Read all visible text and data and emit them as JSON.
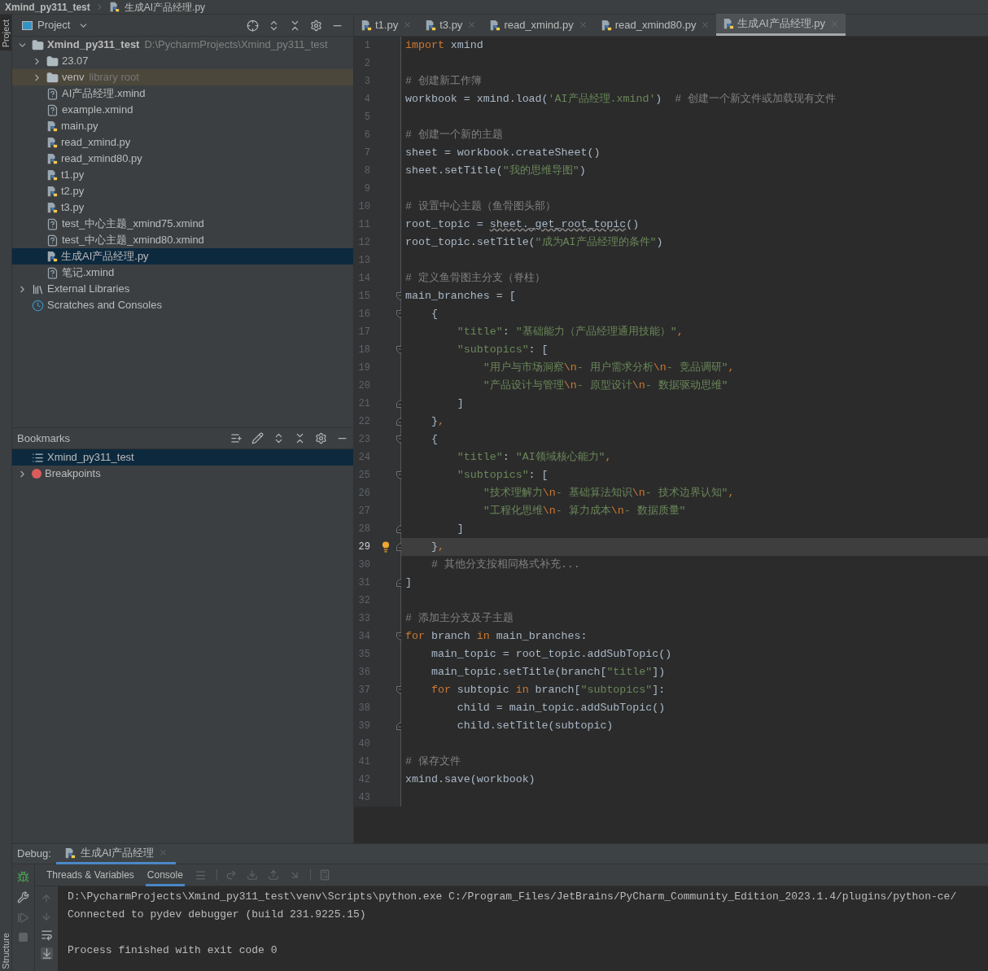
{
  "breadcrumb": [
    {
      "label": "Xmind_py311_test",
      "kind": "project"
    },
    {
      "label": "生成AI产品经理.py",
      "kind": "py"
    }
  ],
  "side_tabs": {
    "top": "Project",
    "bottom": "Structure"
  },
  "project_panel": {
    "title": "Project",
    "tree": [
      {
        "label": "Xmind_py311_test",
        "path": "D:\\PycharmProjects\\Xmind_py311_test",
        "kind": "folder",
        "expanded": true,
        "selected": false,
        "children": [
          {
            "label": "23.07",
            "kind": "folder",
            "expanded": false,
            "selected": false
          },
          {
            "label": "venv",
            "hint": "library root",
            "kind": "libfolder",
            "expanded": false,
            "selected": false
          },
          {
            "label": "AI产品经理.xmind",
            "kind": "other",
            "selected": false
          },
          {
            "label": "example.xmind",
            "kind": "other",
            "selected": false
          },
          {
            "label": "main.py",
            "kind": "py",
            "selected": false
          },
          {
            "label": "read_xmind.py",
            "kind": "py",
            "selected": false
          },
          {
            "label": "read_xmind80.py",
            "kind": "py",
            "selected": false
          },
          {
            "label": "t1.py",
            "kind": "py",
            "selected": false
          },
          {
            "label": "t2.py",
            "kind": "py",
            "selected": false
          },
          {
            "label": "t3.py",
            "kind": "py",
            "selected": false
          },
          {
            "label": "test_中心主题_xmind75.xmind",
            "kind": "other",
            "selected": false
          },
          {
            "label": "test_中心主题_xmind80.xmind",
            "kind": "other",
            "selected": false
          },
          {
            "label": "生成AI产品经理.py",
            "kind": "py",
            "selected": true
          },
          {
            "label": "笔记.xmind",
            "kind": "other",
            "selected": false
          }
        ]
      },
      {
        "label": "External Libraries",
        "kind": "libraries",
        "expanded": false,
        "selected": false
      },
      {
        "label": "Scratches and Consoles",
        "kind": "scratches",
        "selected": false
      }
    ]
  },
  "bookmarks_panel": {
    "title": "Bookmarks",
    "items": [
      {
        "label": "Xmind_py311_test",
        "kind": "list",
        "selected": true
      },
      {
        "label": "Breakpoints",
        "kind": "breakpoints",
        "expanded": false,
        "selected": false
      }
    ]
  },
  "tabs": [
    {
      "label": "t1.py",
      "selected": false
    },
    {
      "label": "t3.py",
      "selected": false
    },
    {
      "label": "read_xmind.py",
      "selected": false
    },
    {
      "label": "read_xmind80.py",
      "selected": false
    },
    {
      "label": "生成AI产品经理.py",
      "selected": true
    }
  ],
  "editor": {
    "lines": [
      {
        "n": "1",
        "current": false,
        "code": [
          {
            "kind": "kw",
            "text": "import"
          },
          {
            "kind": "id",
            "text": " xmind"
          }
        ]
      },
      {
        "n": "2",
        "current": false
      },
      {
        "n": "3",
        "current": false,
        "code": [
          {
            "kind": "cm",
            "text": "# 创建新工作簿"
          }
        ]
      },
      {
        "n": "4",
        "current": false,
        "code": [
          {
            "kind": "id",
            "text": "workbook = xmind.load("
          },
          {
            "kind": "str",
            "text": "'AI产品经理.xmind'"
          },
          {
            "kind": "id",
            "text": ")  "
          },
          {
            "kind": "cm",
            "text": "# 创建一个新文件或加载现有文件"
          }
        ]
      },
      {
        "n": "5",
        "current": false
      },
      {
        "n": "6",
        "current": false,
        "code": [
          {
            "kind": "cm",
            "text": "# 创建一个新的主题"
          }
        ]
      },
      {
        "n": "7",
        "current": false,
        "code": [
          {
            "kind": "id",
            "text": "sheet = workbook.createSheet()"
          }
        ]
      },
      {
        "n": "8",
        "current": false,
        "code": [
          {
            "kind": "id",
            "text": "sheet.setTitle("
          },
          {
            "kind": "str",
            "text": "\"我的思维导图\""
          },
          {
            "kind": "id",
            "text": ")"
          }
        ]
      },
      {
        "n": "9",
        "current": false
      },
      {
        "n": "10",
        "current": false,
        "code": [
          {
            "kind": "cm",
            "text": "# 设置中心主题（鱼骨图头部）"
          }
        ]
      },
      {
        "n": "11",
        "current": false,
        "code": [
          {
            "kind": "id",
            "text": "root_topic = "
          },
          {
            "kind": "warn",
            "text": "sheet._get_root_topic"
          },
          {
            "kind": "id",
            "text": "()"
          }
        ]
      },
      {
        "n": "12",
        "current": false,
        "code": [
          {
            "kind": "id",
            "text": "root_topic.setTitle("
          },
          {
            "kind": "str",
            "text": "\"成为AI产品经理的条件\""
          },
          {
            "kind": "id",
            "text": ")"
          }
        ]
      },
      {
        "n": "13",
        "current": false
      },
      {
        "n": "14",
        "current": false,
        "code": [
          {
            "kind": "cm",
            "text": "# 定义鱼骨图主分支（脊柱）"
          }
        ]
      },
      {
        "n": "15",
        "current": false,
        "kind": "fold-start",
        "code": [
          {
            "kind": "id",
            "text": "main_branches = ["
          }
        ]
      },
      {
        "n": "16",
        "current": false,
        "kind": "fold-start",
        "code": [
          {
            "kind": "id",
            "text": "    {"
          }
        ]
      },
      {
        "n": "17",
        "current": false,
        "code": [
          {
            "kind": "str",
            "text": "        \"title\""
          },
          {
            "kind": "id",
            "text": ": "
          },
          {
            "kind": "str",
            "text": "\"基础能力（产品经理通用技能）\""
          },
          {
            "kind": "kw",
            "text": ","
          }
        ]
      },
      {
        "n": "18",
        "current": false,
        "kind": "fold-start",
        "code": [
          {
            "kind": "str",
            "text": "        \"subtopics\""
          },
          {
            "kind": "id",
            "text": ": ["
          }
        ]
      },
      {
        "n": "19",
        "current": false,
        "code": [
          {
            "kind": "str",
            "text": "            \"用户与市场洞察"
          },
          {
            "kind": "kw",
            "text": "\\n"
          },
          {
            "kind": "str",
            "text": "- 用户需求分析"
          },
          {
            "kind": "kw",
            "text": "\\n"
          },
          {
            "kind": "str",
            "text": "- 竞品调研\""
          },
          {
            "kind": "kw",
            "text": ","
          }
        ]
      },
      {
        "n": "20",
        "current": false,
        "code": [
          {
            "kind": "str",
            "text": "            \"产品设计与管理"
          },
          {
            "kind": "kw",
            "text": "\\n"
          },
          {
            "kind": "str",
            "text": "- 原型设计"
          },
          {
            "kind": "kw",
            "text": "\\n"
          },
          {
            "kind": "str",
            "text": "- 数据驱动思维\""
          }
        ]
      },
      {
        "n": "21",
        "current": false,
        "kind": "fold-end",
        "code": [
          {
            "kind": "id",
            "text": "        ]"
          }
        ]
      },
      {
        "n": "22",
        "current": false,
        "kind": "fold-end",
        "code": [
          {
            "kind": "id",
            "text": "    }"
          },
          {
            "kind": "kw",
            "text": ","
          }
        ]
      },
      {
        "n": "23",
        "current": false,
        "kind": "fold-start",
        "code": [
          {
            "kind": "id",
            "text": "    {"
          }
        ]
      },
      {
        "n": "24",
        "current": false,
        "code": [
          {
            "kind": "str",
            "text": "        \"title\""
          },
          {
            "kind": "id",
            "text": ": "
          },
          {
            "kind": "str",
            "text": "\"AI领域核心能力\""
          },
          {
            "kind": "kw",
            "text": ","
          }
        ]
      },
      {
        "n": "25",
        "current": false,
        "kind": "fold-start",
        "code": [
          {
            "kind": "str",
            "text": "        \"subtopics\""
          },
          {
            "kind": "id",
            "text": ": ["
          }
        ]
      },
      {
        "n": "26",
        "current": false,
        "code": [
          {
            "kind": "str",
            "text": "            \"技术理解力"
          },
          {
            "kind": "kw",
            "text": "\\n"
          },
          {
            "kind": "str",
            "text": "- 基础算法知识"
          },
          {
            "kind": "kw",
            "text": "\\n"
          },
          {
            "kind": "str",
            "text": "- 技术边界认知\""
          },
          {
            "kind": "kw",
            "text": ","
          }
        ]
      },
      {
        "n": "27",
        "current": false,
        "code": [
          {
            "kind": "str",
            "text": "            \"工程化思维"
          },
          {
            "kind": "kw",
            "text": "\\n"
          },
          {
            "kind": "str",
            "text": "- 算力成本"
          },
          {
            "kind": "kw",
            "text": "\\n"
          },
          {
            "kind": "str",
            "text": "- 数据质量\""
          }
        ]
      },
      {
        "n": "28",
        "current": false,
        "kind": "fold-end",
        "code": [
          {
            "kind": "id",
            "text": "        ]"
          }
        ]
      },
      {
        "n": "29",
        "current": true,
        "bulb": true,
        "kind": "fold-end",
        "code": [
          {
            "kind": "id",
            "text": "    }"
          },
          {
            "kind": "kw",
            "text": ","
          }
        ]
      },
      {
        "n": "30",
        "current": false,
        "code": [
          {
            "kind": "cm",
            "text": "    # 其他分支按相同格式补充..."
          }
        ]
      },
      {
        "n": "31",
        "current": false,
        "kind": "fold-end",
        "code": [
          {
            "kind": "id",
            "text": "]"
          }
        ]
      },
      {
        "n": "32",
        "current": false
      },
      {
        "n": "33",
        "current": false,
        "code": [
          {
            "kind": "cm",
            "text": "# 添加主分支及子主题"
          }
        ]
      },
      {
        "n": "34",
        "current": false,
        "kind": "fold-start",
        "code": [
          {
            "kind": "kw",
            "text": "for"
          },
          {
            "kind": "id",
            "text": " branch "
          },
          {
            "kind": "kw",
            "text": "in"
          },
          {
            "kind": "id",
            "text": " main_branches:"
          }
        ]
      },
      {
        "n": "35",
        "current": false,
        "code": [
          {
            "kind": "id",
            "text": "    main_topic = root_topic.addSubTopic()"
          }
        ]
      },
      {
        "n": "36",
        "current": false,
        "code": [
          {
            "kind": "id",
            "text": "    main_topic.setTitle(branch["
          },
          {
            "kind": "str",
            "text": "\"title\""
          },
          {
            "kind": "id",
            "text": "])"
          }
        ]
      },
      {
        "n": "37",
        "current": false,
        "kind": "fold-start",
        "code": [
          {
            "kind": "kw",
            "text": "    for"
          },
          {
            "kind": "id",
            "text": " subtopic "
          },
          {
            "kind": "kw",
            "text": "in"
          },
          {
            "kind": "id",
            "text": " branch["
          },
          {
            "kind": "str",
            "text": "\"subtopics\""
          },
          {
            "kind": "id",
            "text": "]:"
          }
        ]
      },
      {
        "n": "38",
        "current": false,
        "code": [
          {
            "kind": "id",
            "text": "        child = main_topic.addSubTopic()"
          }
        ]
      },
      {
        "n": "39",
        "current": false,
        "kind": "fold-end",
        "code": [
          {
            "kind": "id",
            "text": "        child.setTitle(subtopic)"
          }
        ]
      },
      {
        "n": "40",
        "current": false
      },
      {
        "n": "41",
        "current": false,
        "code": [
          {
            "kind": "cm",
            "text": "# 保存文件"
          }
        ]
      },
      {
        "n": "42",
        "current": false,
        "code": [
          {
            "kind": "id",
            "text": "xmind.save(workbook)"
          }
        ]
      },
      {
        "n": "43",
        "current": false
      }
    ]
  },
  "debug": {
    "title": "Debug:",
    "tabs": [
      {
        "label": "生成AI产品经理",
        "selected": true
      }
    ],
    "subtabs": [
      {
        "label": "Threads & Variables",
        "selected": false
      },
      {
        "label": "Console",
        "selected": true
      }
    ],
    "console": [
      {
        "kind": "output",
        "text": "D:\\PycharmProjects\\Xmind_py311_test\\venv\\Scripts\\python.exe C:/Program_Files/JetBrains/PyCharm_Community_Edition_2023.1.4/plugins/python-ce/"
      },
      {
        "kind": "output",
        "text": "Connected to pydev debugger (build 231.9225.15)"
      },
      {
        "kind": "status",
        "text": "Process finished with exit code 0"
      }
    ]
  }
}
